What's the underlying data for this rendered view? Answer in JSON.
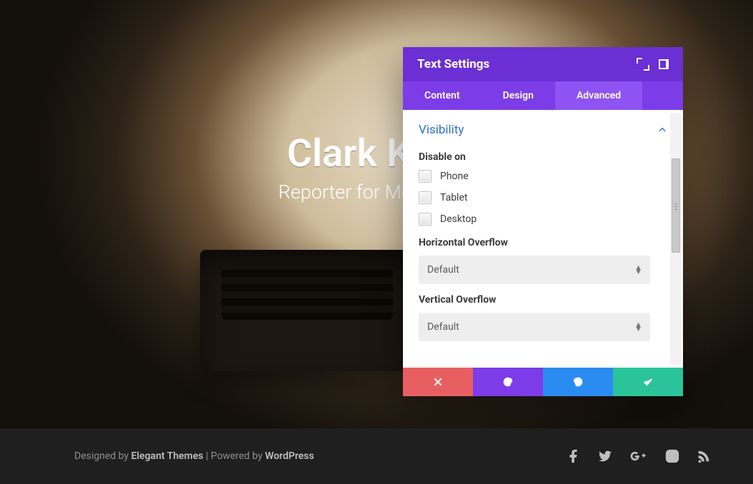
{
  "hero": {
    "title": "Clark Kent",
    "subtitle": "Reporter for Metropolis"
  },
  "panel": {
    "title": "Text Settings",
    "tabs": [
      "Content",
      "Design",
      "Advanced"
    ],
    "active_tab": "Advanced",
    "section": "Visibility",
    "disable_label": "Disable on",
    "disable_options": [
      "Phone",
      "Tablet",
      "Desktop"
    ],
    "h_overflow_label": "Horizontal Overflow",
    "h_overflow_value": "Default",
    "v_overflow_label": "Vertical Overflow",
    "v_overflow_value": "Default"
  },
  "footer": {
    "prefix": "Designed by ",
    "link1": "Elegant Themes",
    "mid": " | Powered by ",
    "link2": "WordPress"
  }
}
